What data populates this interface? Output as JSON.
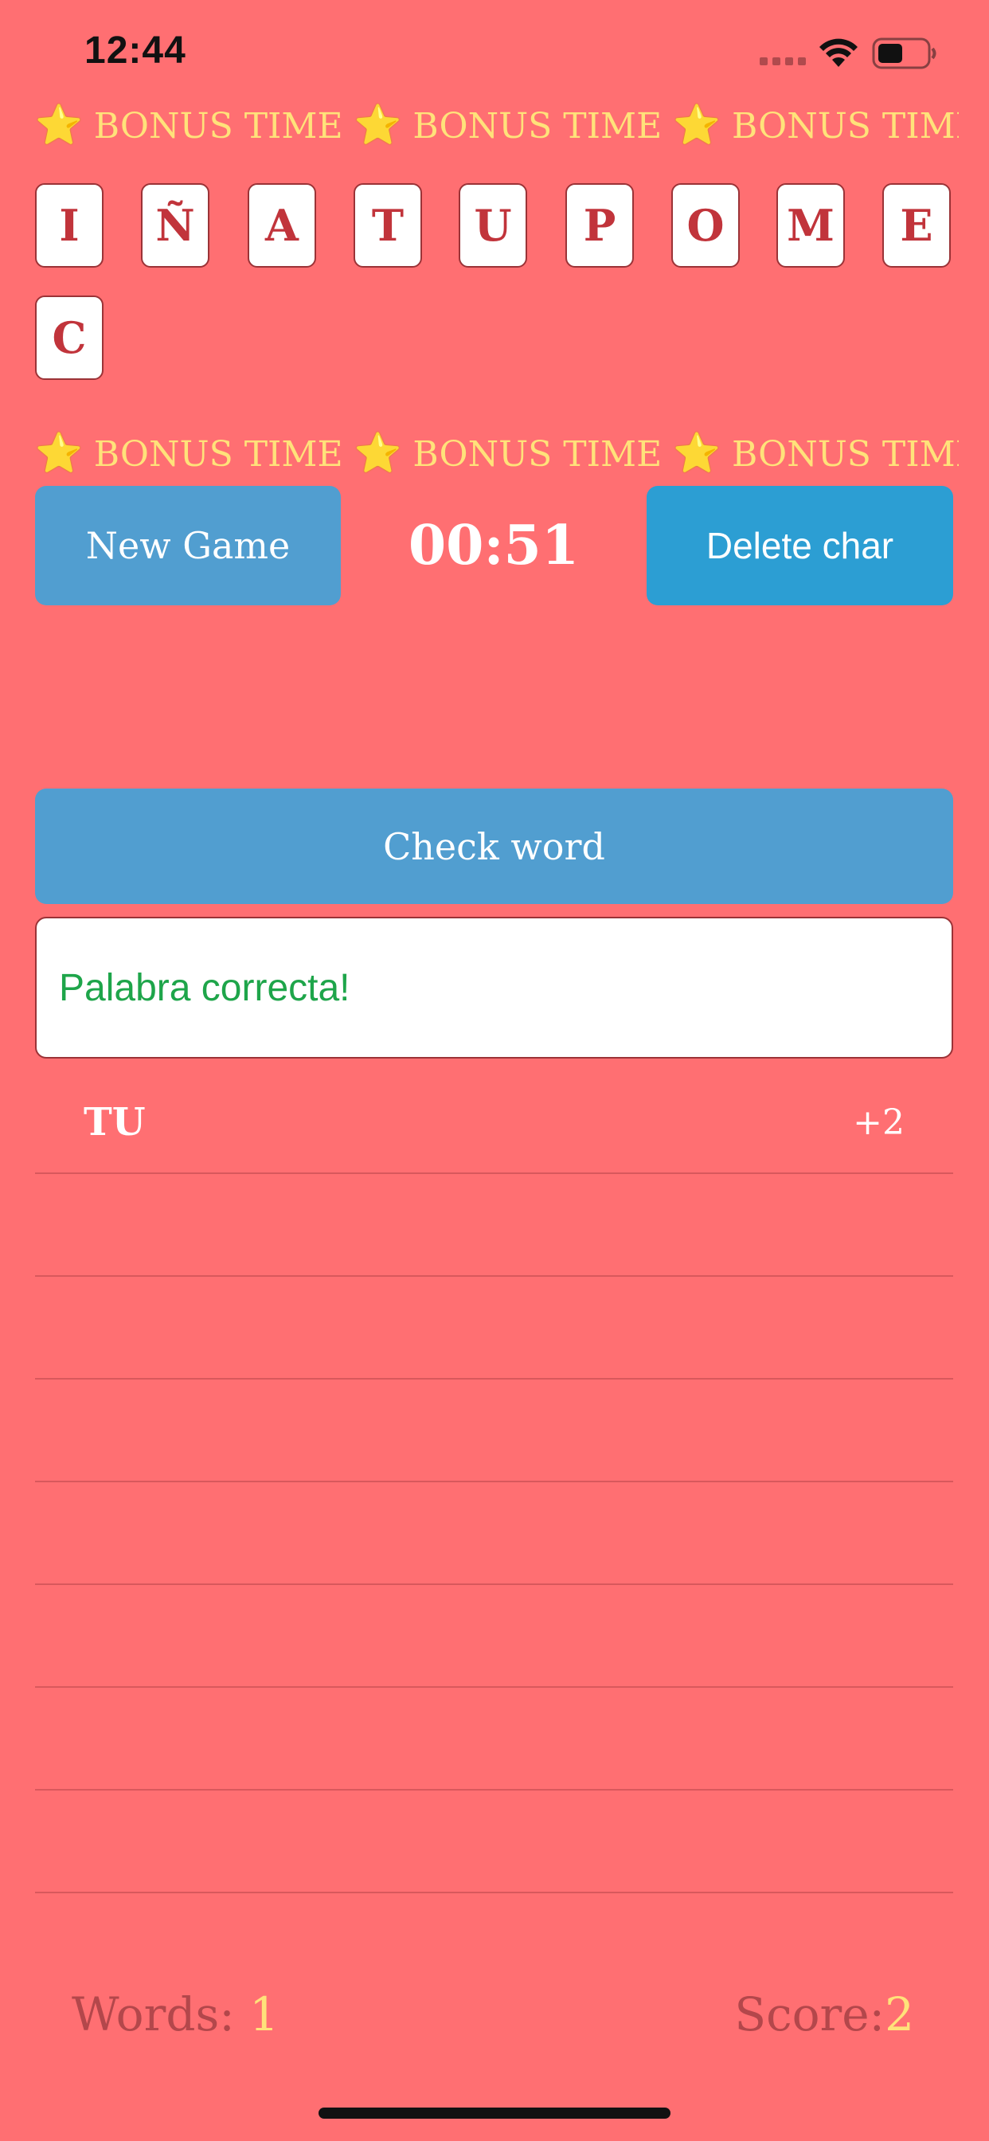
{
  "status_bar": {
    "time": "12:44"
  },
  "bonus_banner": {
    "star_icon": "⭐",
    "text": "BONUS TIME"
  },
  "letters": [
    "I",
    "Ñ",
    "A",
    "T",
    "U",
    "P",
    "O",
    "M",
    "E",
    "C"
  ],
  "controls": {
    "new_game_label": "New Game",
    "timer": "00:51",
    "delete_label": "Delete char",
    "check_label": "Check word"
  },
  "message": "Palabra correcta!",
  "words": [
    {
      "word": "TU",
      "points": "+2"
    }
  ],
  "footer": {
    "words_label": "Words:",
    "words_value": "1",
    "score_label": "Score:",
    "score_value": "2"
  },
  "colors": {
    "background": "#ff6f72",
    "accent_button": "#519ed0",
    "delete_button": "#2c9ed3",
    "success_text": "#1ea54a",
    "bonus_text": "#ffe27a"
  }
}
